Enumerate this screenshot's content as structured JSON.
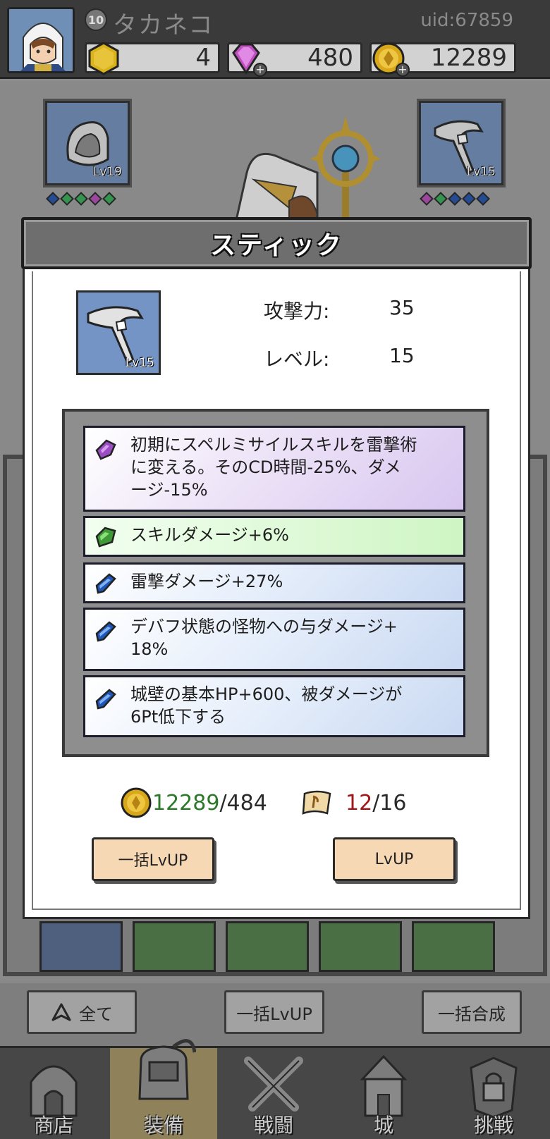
{
  "header": {
    "player_level": "10",
    "player_name": "タカネコ",
    "uid": "uid:67859",
    "resources": {
      "gold_hex": "4",
      "gems": "480",
      "coins": "12289"
    }
  },
  "equipment": {
    "left_slot": {
      "level": "Lv19",
      "icon": "hood-icon",
      "gems": [
        "#1f4fa8",
        "#34a853",
        "#34a853",
        "#b04ab4",
        "#34a853"
      ]
    },
    "right_slot": {
      "level": "Lv15",
      "icon": "stick-icon",
      "gems": [
        "#b04ab4",
        "#34a853",
        "#1f4fa8",
        "#1f4fa8",
        "#1f4fa8"
      ]
    }
  },
  "modal": {
    "title": "スティック",
    "item_level": "Lv15",
    "stats": [
      {
        "label": "攻撃力:",
        "value": "35"
      },
      {
        "label": "レベル:",
        "value": "15"
      }
    ],
    "skills": [
      {
        "color": "purple",
        "text_line1": "初期にスペルミサイルスキルを雷撃術",
        "text_line2": "に変える。そのCD時間-25%、ダメ",
        "text_line3": "ージ-15%"
      },
      {
        "color": "green",
        "text_line1": "スキルダメージ+6%"
      },
      {
        "color": "blue",
        "text_line1": "雷撃ダメージ+27%"
      },
      {
        "color": "blue",
        "text_line1": "デバフ状態の怪物への与ダメージ+",
        "text_line2": "18%"
      },
      {
        "color": "blue",
        "text_line1": "城壁の基本HP+600、被ダメージが",
        "text_line2": "6Pt低下する"
      }
    ],
    "cost": {
      "coins_have": "12289",
      "coins_need": "/484",
      "scroll_have": "12",
      "scroll_need": "/16"
    },
    "buttons": {
      "bulk_lvup": "一括LvUP",
      "lvup": "LvUP"
    }
  },
  "toolbar": {
    "all": "全て",
    "bulk_lvup": "一括LvUP",
    "bulk_merge": "一括合成"
  },
  "nav": {
    "items": [
      {
        "label": "商店",
        "icon": "shop-icon"
      },
      {
        "label": "装備",
        "icon": "bag-icon"
      },
      {
        "label": "戦闘",
        "icon": "swords-icon"
      },
      {
        "label": "城",
        "icon": "castle-icon"
      },
      {
        "label": "挑戦",
        "icon": "lock-icon"
      }
    ]
  },
  "colors": {
    "accent_green": "#2a7a2a",
    "accent_red": "#a01818",
    "button_bg": "#f6d9b4"
  }
}
